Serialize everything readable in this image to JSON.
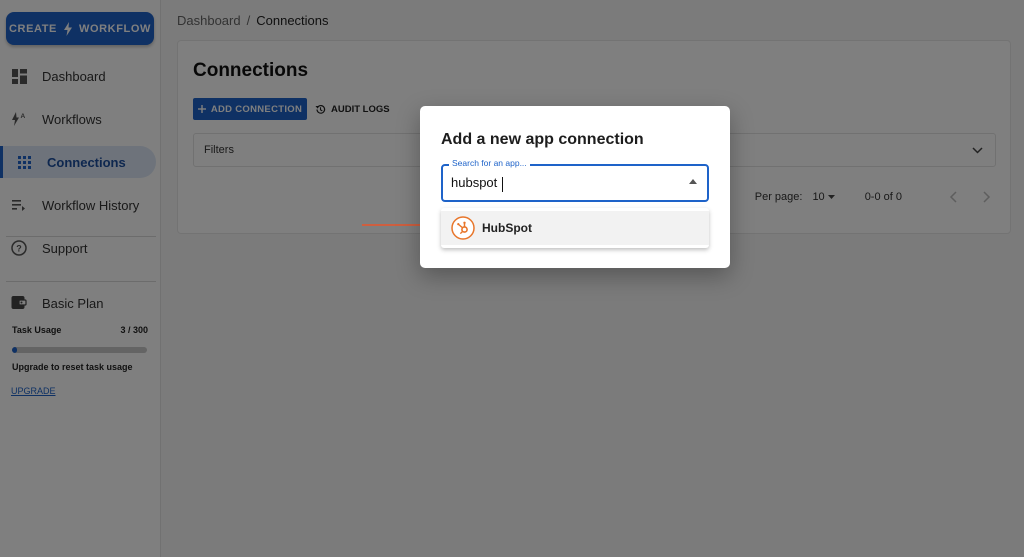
{
  "sidebar": {
    "create_button": {
      "label_left": "CREATE",
      "label_right": "WORKFLOW",
      "icon": "bolt-icon"
    },
    "items": [
      {
        "label": "Dashboard",
        "icon": "dashboard-icon",
        "active": false
      },
      {
        "label": "Workflows",
        "icon": "workflows-icon",
        "active": false
      },
      {
        "label": "Connections",
        "icon": "apps-grid-icon",
        "active": true
      },
      {
        "label": "Workflow History",
        "icon": "history-list-icon",
        "active": false
      },
      {
        "label": "Support",
        "icon": "help-circle-icon",
        "active": false
      }
    ],
    "plan": {
      "label": "Basic Plan",
      "icon": "wallet-icon"
    },
    "usage": {
      "label": "Task Usage",
      "count": "3 / 300",
      "fraction": 0.01,
      "note": "Upgrade to reset task usage",
      "upgrade_link": "UPGRADE"
    }
  },
  "breadcrumb": {
    "root": "Dashboard",
    "separator": "/",
    "current": "Connections"
  },
  "page": {
    "title": "Connections",
    "add_connection_label": "ADD CONNECTION",
    "audit_logs_label": "AUDIT LOGS",
    "filters_label": "Filters",
    "pagination": {
      "per_page_label": "Per page:",
      "per_page_value": "10",
      "range": "0-0 of 0"
    }
  },
  "modal": {
    "title": "Add a new app connection",
    "search": {
      "label": "Search for an app...",
      "value": "hubspot"
    },
    "options": [
      {
        "name": "HubSpot",
        "icon": "hubspot-logo-icon",
        "accent": "#e8762b"
      }
    ]
  },
  "colors": {
    "primary": "#1e63c9",
    "annotation_arrow": "#e8552b"
  }
}
